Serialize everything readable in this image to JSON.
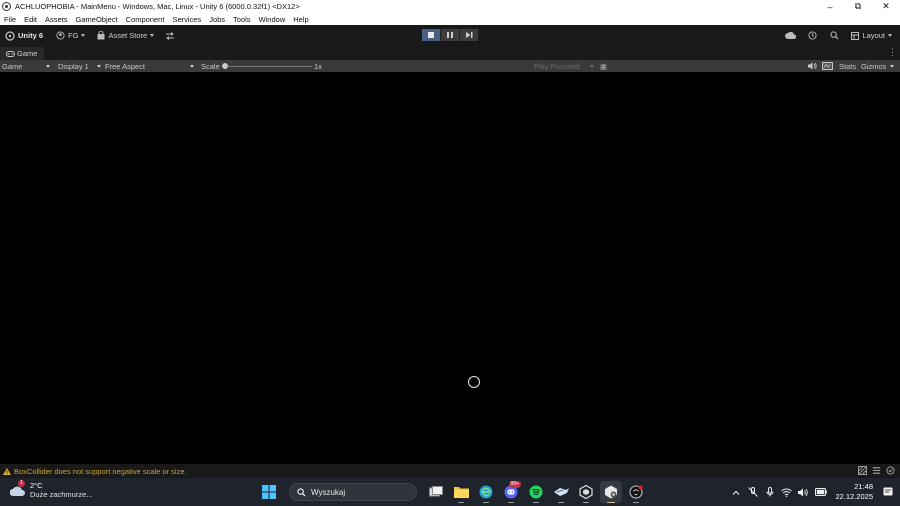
{
  "window": {
    "title": "ACHLUOPHOBIA - MainMenu - Windows, Mac, Linux - Unity 6 (6000.0.32f1) <DX12>",
    "controls": [
      "minimize",
      "restore",
      "close"
    ]
  },
  "menu": [
    "File",
    "Edit",
    "Assets",
    "GameObject",
    "Component",
    "Services",
    "Jobs",
    "Tools",
    "Window",
    "Help"
  ],
  "toolbar": {
    "unity_label": "Unity 6",
    "account_label": "FG",
    "asset_store_label": "Asset Store",
    "layout_label": "Layout"
  },
  "tabs": {
    "game": "Game"
  },
  "game_toolbar": {
    "view_mode": "Game",
    "display": "Display 1",
    "aspect": "Free Aspect",
    "scale_label": "Scale",
    "scale_value": "1x",
    "play_mode": "Play Focused",
    "stats": "Stats",
    "gizmos": "Gizmos"
  },
  "status": {
    "warning": "BoxCollider does not support negative scale or size."
  },
  "taskbar": {
    "weather_temp": "2°C",
    "weather_desc": "Duże zachmurze...",
    "weather_badge": "1",
    "search_placeholder": "Wyszukaj",
    "discord_badge": "99+",
    "time": "21:48",
    "date": "22.12.2025"
  },
  "colors": {
    "accent_play": "#4a5f85",
    "warning": "#c8a33a",
    "taskbar": "#1f242c"
  }
}
